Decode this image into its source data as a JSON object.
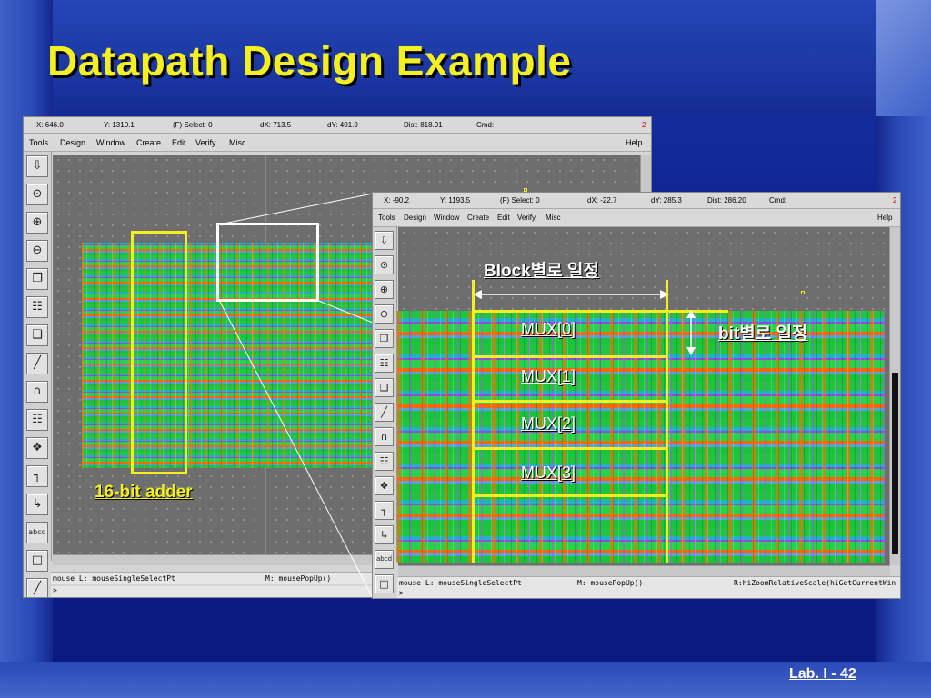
{
  "slide": {
    "title": "Datapath Design Example",
    "page_number": "Lab. I - 42"
  },
  "window_main": {
    "coord": {
      "x": "X:  646.0",
      "y": "Y:  1310.1",
      "select": "(F) Select: 0",
      "dx": "dX:  713.5",
      "dy": "dY:  401.9",
      "dist": "Dist: 818.91",
      "cmd": "Cmd:",
      "num": "2"
    },
    "menu": [
      "Tools",
      "Design",
      "Window",
      "Create",
      "Edit",
      "Verify",
      "Misc"
    ],
    "help": "Help",
    "status_left": "mouse L: mouseSingleSelectPt",
    "status_mid": "M: mousePopUp()",
    "prompt": ">"
  },
  "window_zoom": {
    "coord": {
      "x": "X:  -90.2",
      "y": "Y:  1193.5",
      "select": "(F) Select: 0",
      "dx": "dX:  -22.7",
      "dy": "dY:  285.3",
      "dist": "Dist: 286.20",
      "cmd": "Cmd:",
      "num": "2"
    },
    "menu": [
      "Tools",
      "Design",
      "Window",
      "Create",
      "Edit",
      "Verify",
      "Misc"
    ],
    "help": "Help",
    "status_left": "mouse L: mouseSingleSelectPt",
    "status_mid": "M: mousePopUp()",
    "status_right": "R:hiZoomRelativeScale(hiGetCurrentWin",
    "prompt": ">"
  },
  "annotations": {
    "adder_label": "16-bit adder",
    "block_label": "Block별로 일정",
    "bit_label": "bit별로 일정",
    "mux": [
      "MUX[0]",
      "MUX[1]",
      "MUX[2]",
      "MUX[3]"
    ]
  },
  "tool_icons": [
    "save-icon",
    "zoom-fit-icon",
    "zoom-in-icon",
    "zoom-out-icon",
    "copy-icon",
    "instance-icon",
    "stretch-icon",
    "ruler-icon",
    "arc-icon",
    "pins-icon",
    "array-icon",
    "path-icon",
    "move-icon",
    "label-icon",
    "delete-icon",
    "measure-icon"
  ],
  "colors": {
    "title": "#f4f020",
    "highlight_box": "#f4f020",
    "zoom_box": "#ffffff"
  }
}
